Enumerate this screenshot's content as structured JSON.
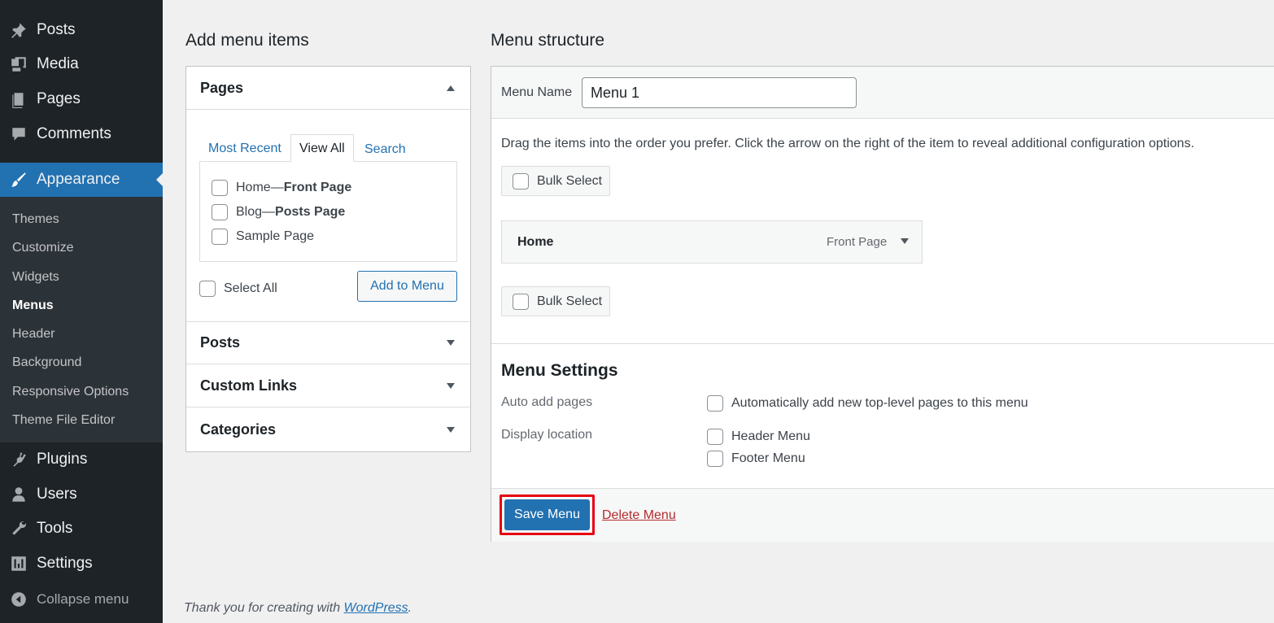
{
  "sidebar": {
    "items": [
      {
        "label": "Posts",
        "icon": "pin-icon"
      },
      {
        "label": "Media",
        "icon": "media-icon"
      },
      {
        "label": "Pages",
        "icon": "pages-icon"
      },
      {
        "label": "Comments",
        "icon": "comment-icon"
      },
      {
        "label": "Appearance",
        "icon": "brush-icon"
      },
      {
        "label": "Plugins",
        "icon": "plugin-icon"
      },
      {
        "label": "Users",
        "icon": "user-icon"
      },
      {
        "label": "Tools",
        "icon": "wrench-icon"
      },
      {
        "label": "Settings",
        "icon": "settings-icon"
      }
    ],
    "submenu": [
      "Themes",
      "Customize",
      "Widgets",
      "Menus",
      "Header",
      "Background",
      "Responsive Options",
      "Theme File Editor"
    ],
    "current_submenu": "Menus",
    "collapse_label": "Collapse menu"
  },
  "add_items": {
    "heading": "Add menu items",
    "sections": [
      "Pages",
      "Posts",
      "Custom Links",
      "Categories"
    ],
    "tabs": [
      "Most Recent",
      "View All",
      "Search"
    ],
    "active_tab": "View All",
    "pages": [
      {
        "title": "Home",
        "sep": " — ",
        "state": "Front Page"
      },
      {
        "title": "Blog",
        "sep": " — ",
        "state": "Posts Page"
      },
      {
        "title": "Sample Page",
        "sep": "",
        "state": ""
      }
    ],
    "select_all": "Select All",
    "add_button": "Add to Menu"
  },
  "structure": {
    "heading": "Menu structure",
    "menu_name_label": "Menu Name",
    "menu_name_value": "Menu 1",
    "instructions": "Drag the items into the order you prefer. Click the arrow on the right of the item to reveal additional configuration options.",
    "bulk_select": "Bulk Select",
    "menu_items": [
      {
        "title": "Home",
        "type": "Front Page"
      }
    ],
    "settings_heading": "Menu Settings",
    "auto_add_label": "Auto add pages",
    "auto_add_option": "Automatically add new top-level pages to this menu",
    "display_location_label": "Display location",
    "locations": [
      "Header Menu",
      "Footer Menu"
    ],
    "save_button": "Save Menu",
    "delete_link": "Delete Menu"
  },
  "footer": {
    "text": "Thank you for creating with ",
    "link": "WordPress",
    "suffix": "."
  },
  "colors": {
    "accent": "#2271b1",
    "sidebar": "#1d2327",
    "highlight": "#e60012",
    "delete": "#b32d2e"
  }
}
